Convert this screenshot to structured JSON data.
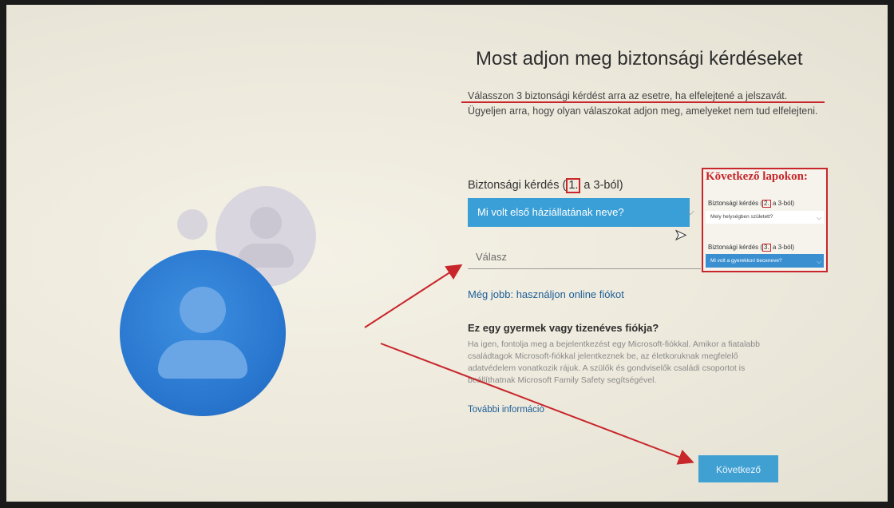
{
  "page": {
    "title": "Most adjon meg biztonsági kérdéseket",
    "intro_lead": "Válasszon 3 biztonsági kérdést arra az esetre, ha elfelejtené a jelszavát.",
    "intro_rest": "Ügyeljen arra, hogy olyan válaszokat adjon meg, amelyeket nem tud elfelejteni."
  },
  "question": {
    "label_prefix": "Biztonsági kérdés (",
    "label_number": "1.",
    "label_suffix": " a 3-ból)",
    "selected": "Mi volt első háziállatának neve?",
    "chevron_glyph": "⌵"
  },
  "answer": {
    "placeholder": "Válasz",
    "value": ""
  },
  "online_link": "Még jobb: használjon online fiókot",
  "child": {
    "title": "Ez egy gyermek vagy tizenéves fiókja?",
    "text": "Ha igen, fontolja meg a bejelentkezést egy Microsoft-fiókkal. Amikor a fiatalabb családtagok Microsoft-fiókkal jelentkeznek be, az életkoruknak megfelelő adatvédelem vonatkozik rájuk. A szülők és gondviselők családi csoportot is beállíthatnak Microsoft Family Safety segítségével.",
    "more_link": "További információ"
  },
  "next_button": "Következő",
  "annotation": {
    "title": "Következő lapokon:",
    "q2_prefix": "Biztonsági kérdés (",
    "q2_number": "2.",
    "q2_suffix": " a 3-ból)",
    "q2_answer": "Mely helységben született?",
    "q3_prefix": "Biztonsági kérdés (",
    "q3_number": "3.",
    "q3_suffix": " a 3-ból)",
    "q3_answer": "Mi volt a gyerekkori beceneve?"
  },
  "colors": {
    "accent": "#3a9fd6",
    "annotation_red": "#c8262b",
    "link": "#1d5f97"
  }
}
